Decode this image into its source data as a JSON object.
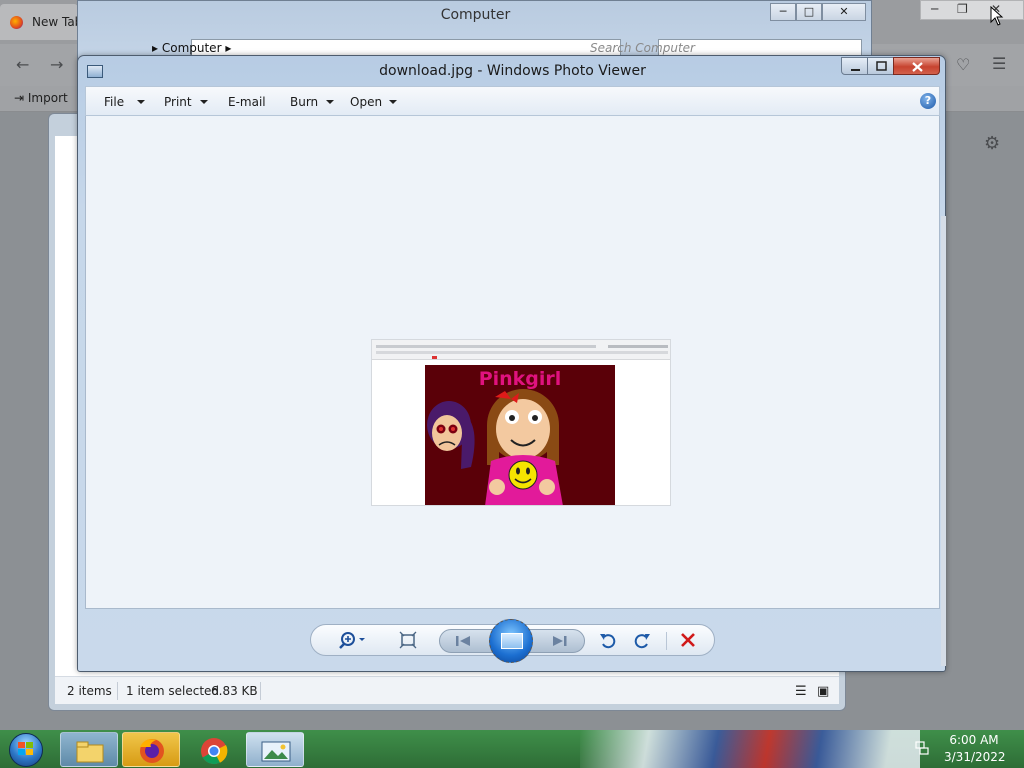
{
  "browser": {
    "tab_label": "New Tab",
    "bookmark_import_label": "Import"
  },
  "computer_window": {
    "title": "Computer",
    "address_label": "Computer",
    "search_placeholder": "Search Computer"
  },
  "explorer_window": {
    "status_items": "2 items",
    "status_selected": "1 item selected",
    "status_size": "6.83 KB"
  },
  "photo_viewer": {
    "title": "download.jpg - Windows Photo Viewer",
    "menu": [
      {
        "label": "File",
        "has_dropdown": true
      },
      {
        "label": "Print",
        "has_dropdown": true
      },
      {
        "label": "E-mail",
        "has_dropdown": false
      },
      {
        "label": "Burn",
        "has_dropdown": true
      },
      {
        "label": "Open",
        "has_dropdown": true
      }
    ],
    "help_glyph": "?",
    "image_caption": "Pinkgirl",
    "controls": [
      "zoom-icon",
      "actual-size-icon",
      "previous-icon",
      "slideshow-icon",
      "next-icon",
      "rotate-counterclockwise-icon",
      "rotate-clockwise-icon",
      "delete-icon"
    ]
  },
  "taskbar": {
    "apps": [
      "windows-explorer",
      "firefox",
      "chrome",
      "windows-photo-viewer"
    ],
    "clock_time": "6:00 AM",
    "clock_date": "3/31/2022"
  },
  "colors": {
    "accent_blue": "#1c6fd1",
    "close_red": "#c7432f",
    "delete_red": "#d01919",
    "image_caption_pink": "#e0127f",
    "image_background": "#5a0008",
    "taskbar_green": "#2e6d36"
  }
}
